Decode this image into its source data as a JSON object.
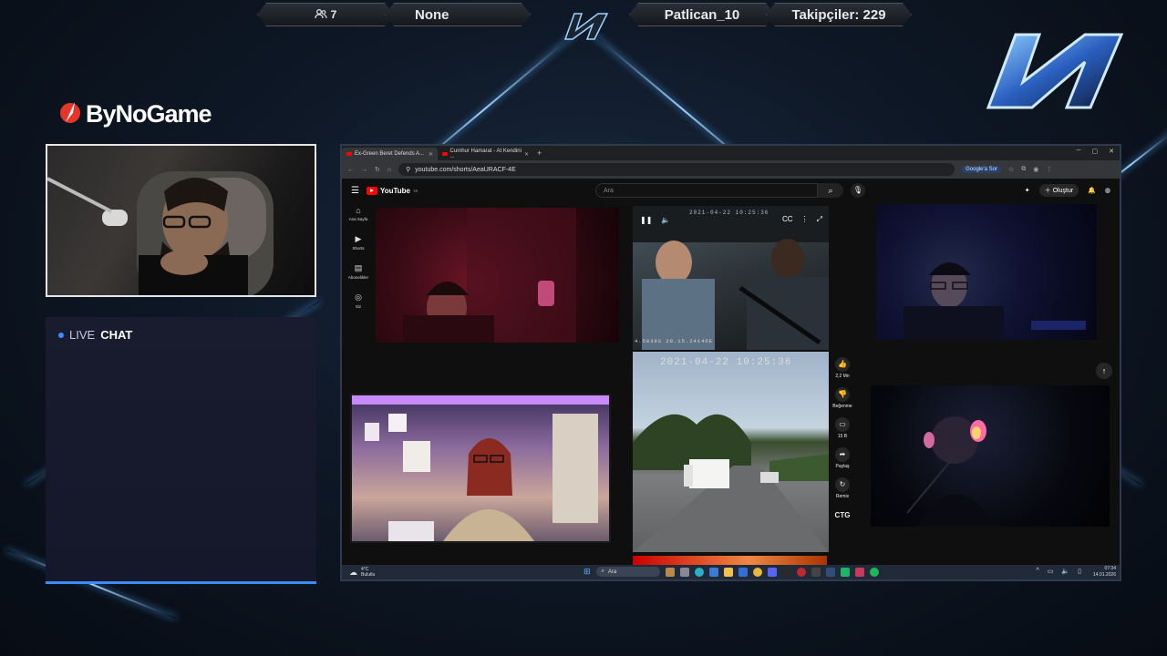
{
  "overlay": {
    "viewers_count": "7",
    "now_playing": "None",
    "channel_name": "Patlican_10",
    "followers": "Takipçiler: 229",
    "brand": "ByNoGame",
    "live_label": "LIVE",
    "chat_label": "CHAT",
    "colors": {
      "accent": "#3a8cff",
      "bg": "#0b1320"
    }
  },
  "browser": {
    "tabs": [
      {
        "label": "Ex-Green Beret Defends A..."
      },
      {
        "label": "Cumhur Hamarat - At Kendini ..."
      }
    ],
    "new_tab": "+",
    "url": "youtube.com/shorts/AeaURACF-4E",
    "google_btn": "Google'a Sor"
  },
  "youtube": {
    "logo": "YouTube",
    "region": "TR",
    "search_placeholder": "Ara",
    "create_label": "Oluştur",
    "sidebar": [
      {
        "label": "Ana Sayfa",
        "icon": "home-icon"
      },
      {
        "label": "Shorts",
        "icon": "shorts-icon"
      },
      {
        "label": "Abonelikler",
        "icon": "subscriptions-icon"
      },
      {
        "label": "Siz",
        "icon": "you-icon"
      }
    ],
    "timestamp_top": "2021-04-22  10:25:36",
    "timestamp_main": "2021-04-22  10:25:36",
    "timestamp_small": "4.5039S  28.15.2414OE",
    "actions": {
      "likes": "2,2 Mn",
      "dislike": "Beğenme",
      "comments": "15 B",
      "share": "Paylaş",
      "remix": "Remix",
      "channel_tag": "CTG"
    }
  },
  "taskbar": {
    "temp": "4°C",
    "weather": "Bulutlu",
    "search": "Ara",
    "time": "07:34",
    "date": "14.01.2026"
  }
}
